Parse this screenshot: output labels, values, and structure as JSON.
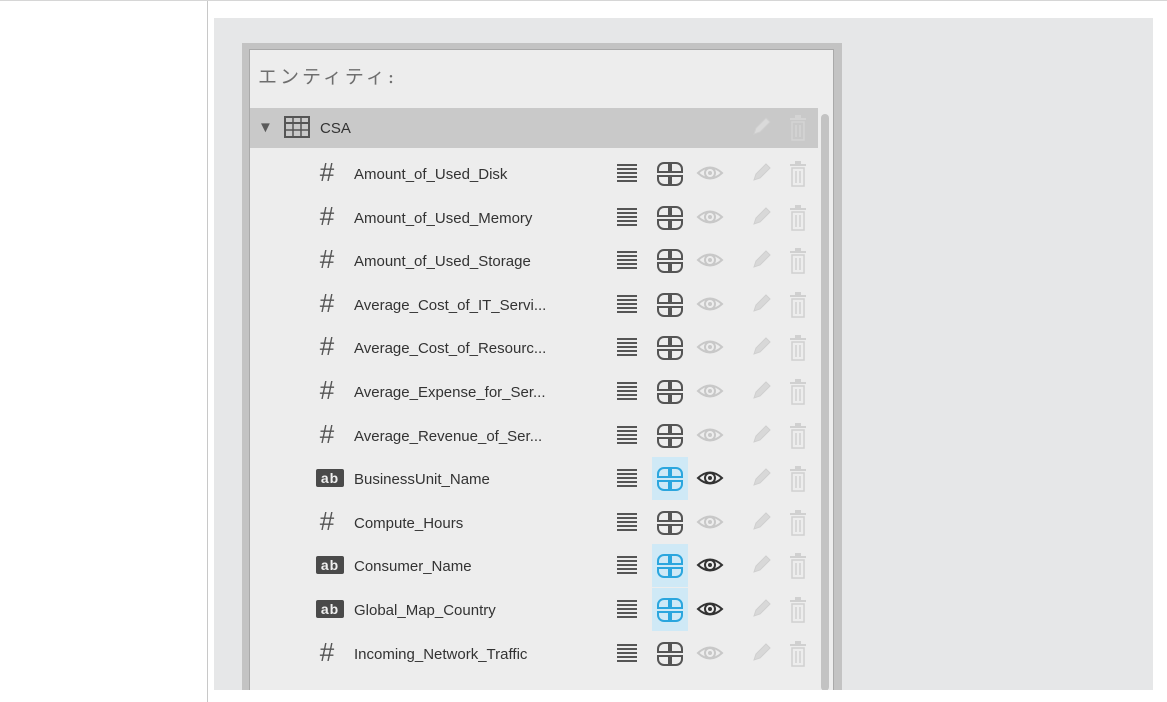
{
  "panel": {
    "title": "エンティティ:"
  },
  "entity": {
    "name": "CSA",
    "expanded": true,
    "icon": "table-icon"
  },
  "fields": [
    {
      "name": "Amount_of_Used_Disk",
      "type": "numeric",
      "type_label": "#",
      "dimension_active": false,
      "visible": false
    },
    {
      "name": "Amount_of_Used_Memory",
      "type": "numeric",
      "type_label": "#",
      "dimension_active": false,
      "visible": false
    },
    {
      "name": "Amount_of_Used_Storage",
      "type": "numeric",
      "type_label": "#",
      "dimension_active": false,
      "visible": false
    },
    {
      "name": "Average_Cost_of_IT_Servi...",
      "type": "numeric",
      "type_label": "#",
      "dimension_active": false,
      "visible": false
    },
    {
      "name": "Average_Cost_of_Resourc...",
      "type": "numeric",
      "type_label": "#",
      "dimension_active": false,
      "visible": false
    },
    {
      "name": "Average_Expense_for_Ser...",
      "type": "numeric",
      "type_label": "#",
      "dimension_active": false,
      "visible": false
    },
    {
      "name": "Average_Revenue_of_Ser...",
      "type": "numeric",
      "type_label": "#",
      "dimension_active": false,
      "visible": false
    },
    {
      "name": "BusinessUnit_Name",
      "type": "text",
      "type_label": "ab",
      "dimension_active": true,
      "visible": true
    },
    {
      "name": "Compute_Hours",
      "type": "numeric",
      "type_label": "#",
      "dimension_active": false,
      "visible": false
    },
    {
      "name": "Consumer_Name",
      "type": "text",
      "type_label": "ab",
      "dimension_active": true,
      "visible": true
    },
    {
      "name": "Global_Map_Country",
      "type": "text",
      "type_label": "ab",
      "dimension_active": true,
      "visible": true
    },
    {
      "name": "Incoming_Network_Traffic",
      "type": "numeric",
      "type_label": "#",
      "dimension_active": false,
      "visible": false
    }
  ],
  "colors": {
    "active_dimension": "#2ba6de",
    "active_dimension_bg": "#cfe9f6",
    "inactive_icon": "#555555",
    "disabled_icon": "#c8c8c8",
    "entity_header_bg": "#c9c9c9"
  }
}
